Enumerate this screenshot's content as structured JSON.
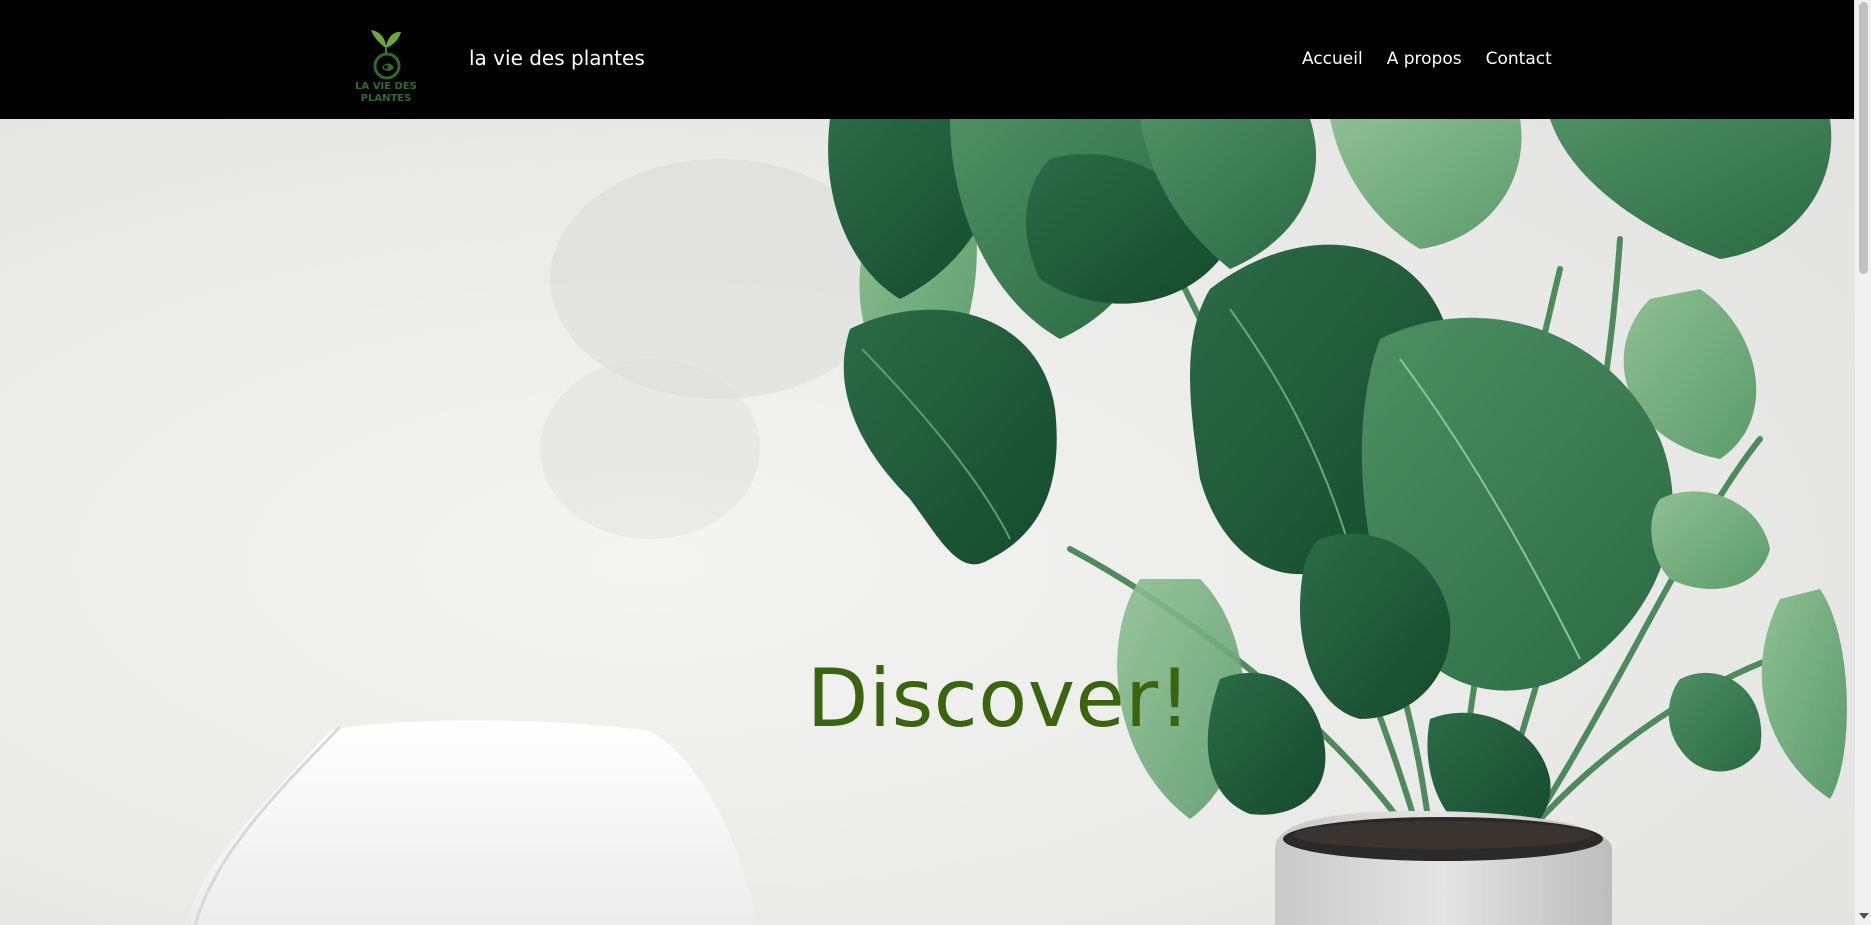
{
  "header": {
    "logo_text": "LA VIE DES PLANTES",
    "site_title": "la vie des plantes",
    "nav": [
      {
        "label": "Accueil"
      },
      {
        "label": "A propos"
      },
      {
        "label": "Contact"
      }
    ]
  },
  "hero": {
    "heading": "Discover!"
  },
  "colors": {
    "header_bg": "#000000",
    "nav_text": "#ffffff",
    "heading_green": "#3b6410",
    "logo_green": "#2f6b2c",
    "wall": "#eeeeec"
  },
  "icons": {
    "logo": "sprout-icon",
    "scroll_down": "chevron-down-icon"
  }
}
